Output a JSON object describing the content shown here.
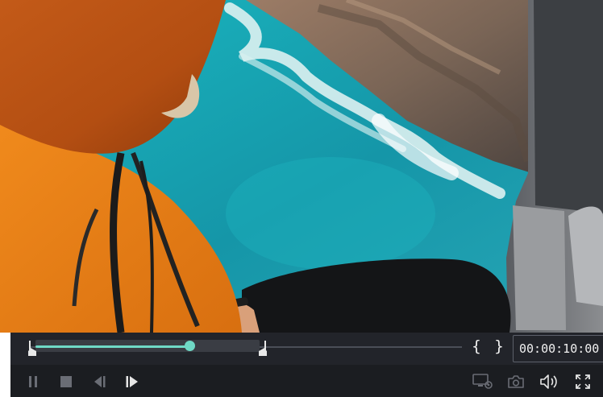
{
  "player": {
    "timecode": "00:00:10:00",
    "playback_progress": 0.37,
    "selection": {
      "in": 0.013,
      "out": 0.532
    }
  },
  "markers": {
    "mark_in_label": "{",
    "mark_out_label": "}"
  },
  "colors": {
    "accent": "#6fd9c6",
    "panel": "#22242a",
    "controls_bg": "#1b1d21",
    "icon": "#e6e6e6",
    "icon_muted": "#6a6d75"
  },
  "icons": {
    "pause": "pause-icon",
    "stop": "stop-icon",
    "previous_frame": "previous-frame-icon",
    "next_frame": "next-frame-icon",
    "render_settings": "display-settings-icon",
    "snapshot": "camera-icon",
    "volume": "volume-icon",
    "fullscreen": "fullscreen-icon"
  }
}
